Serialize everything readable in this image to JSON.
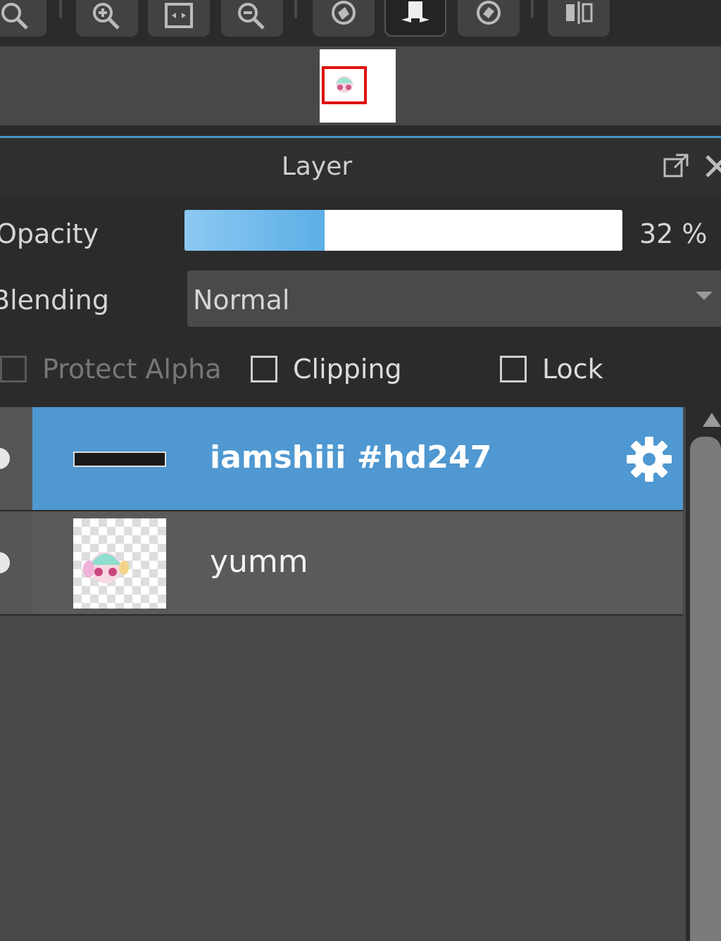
{
  "toolbar": {
    "buttons": [
      {
        "icon": "zoom-icon"
      },
      {
        "icon": "zoom-in-icon"
      },
      {
        "icon": "fit-screen-icon"
      },
      {
        "icon": "zoom-out-icon"
      },
      {
        "icon": "rotate-left-icon"
      },
      {
        "icon": "flip-icon"
      },
      {
        "icon": "rotate-right-icon"
      },
      {
        "icon": "split-view-icon"
      }
    ]
  },
  "panel": {
    "title": "Layer",
    "opacity_label": "Opacity",
    "opacity_value": 32,
    "opacity_text": "32 %",
    "blending_label": "Blending",
    "blending_value": "Normal",
    "checkboxes": {
      "protect_alpha": "Protect Alpha",
      "clipping": "Clipping",
      "lock": "Lock"
    }
  },
  "layers": [
    {
      "name": "iamshiii #hd247",
      "selected": true,
      "type": "text"
    },
    {
      "name": "yumm",
      "selected": false,
      "type": "image"
    }
  ],
  "colors": {
    "accent": "#4f98d1",
    "navigator_frame": "#e01010",
    "opacity_fill": "#5caee6"
  }
}
